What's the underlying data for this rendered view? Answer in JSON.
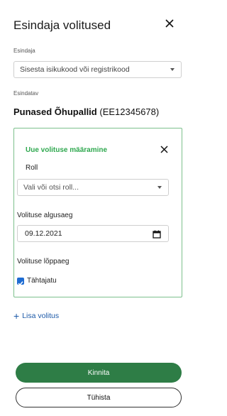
{
  "dialog": {
    "title": "Esindaja volitused",
    "close_icon": "close-icon"
  },
  "representative_select": {
    "label": "Esindaja",
    "placeholder": "Sisesta isikukood või registrikood"
  },
  "represented": {
    "label": "Esindatav",
    "name": "Punased Õhupallid",
    "code": "(EE12345678)"
  },
  "mandate_card": {
    "title": "Uue volituse määramine",
    "role_label": "Roll",
    "role_placeholder": "Vali või otsi roll...",
    "start_label": "Volituse algusaeg",
    "start_value": "09.12.2021",
    "end_label": "Volituse lõppaeg",
    "indefinite_label": "Tähtajatu",
    "indefinite_checked": true
  },
  "add_mandate_label": "Lisa volitus",
  "actions": {
    "confirm_label": "Kinnita",
    "cancel_label": "Tühista"
  },
  "colors": {
    "accent_green": "#2fa84f",
    "primary_button": "#2e7d46",
    "link_blue": "#1d5aa8",
    "checkbox_blue": "#1e6cd2"
  }
}
